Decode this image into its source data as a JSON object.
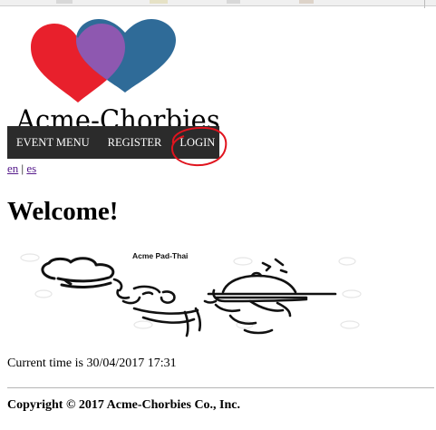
{
  "logo": {
    "text": "Acme-Chorbies"
  },
  "menu": {
    "items": [
      {
        "label": "EVENT MENU"
      },
      {
        "label": "REGISTER"
      },
      {
        "label": "LOGIN"
      }
    ]
  },
  "lang": {
    "en": "en",
    "separator": "|",
    "es": "es"
  },
  "welcome": {
    "title": "Welcome!"
  },
  "banner": {
    "caption": "Acme Pad-Thai"
  },
  "footer": {
    "time_text": "Current time is 30/04/2017 17:31",
    "copyright": "Copyright © 2017 Acme-Chorbies Co., Inc."
  },
  "colors": {
    "menu_bg": "#2b2b2b",
    "heart_red": "#e8202c",
    "heart_blue": "#2f6b98",
    "heart_overlap": "#8e58b0",
    "annotation_red": "#e0141e"
  }
}
